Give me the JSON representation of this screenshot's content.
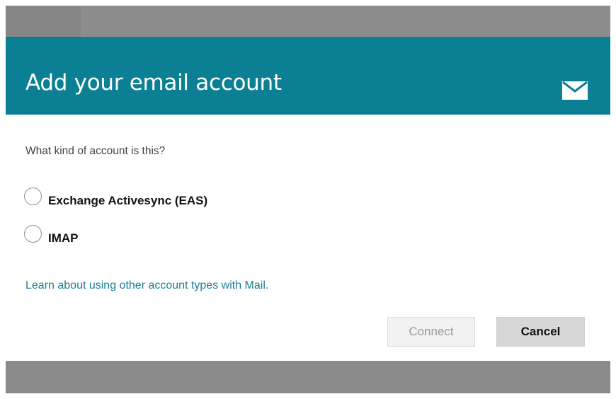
{
  "dialog": {
    "title": "Add your email account",
    "header_icon": "envelope-icon",
    "question": "What kind of account is this?",
    "options": [
      {
        "label": "Exchange Activesync (EAS)",
        "selected": false
      },
      {
        "label": "IMAP",
        "selected": false
      }
    ],
    "learn_link": "Learn about using other account types with Mail.",
    "buttons": {
      "connect": {
        "label": "Connect",
        "enabled": false
      },
      "cancel": {
        "label": "Cancel",
        "enabled": true
      }
    }
  },
  "colors": {
    "header_bg": "#0b7f93",
    "link": "#1a7f93",
    "overlay": "#8c8c8c"
  }
}
